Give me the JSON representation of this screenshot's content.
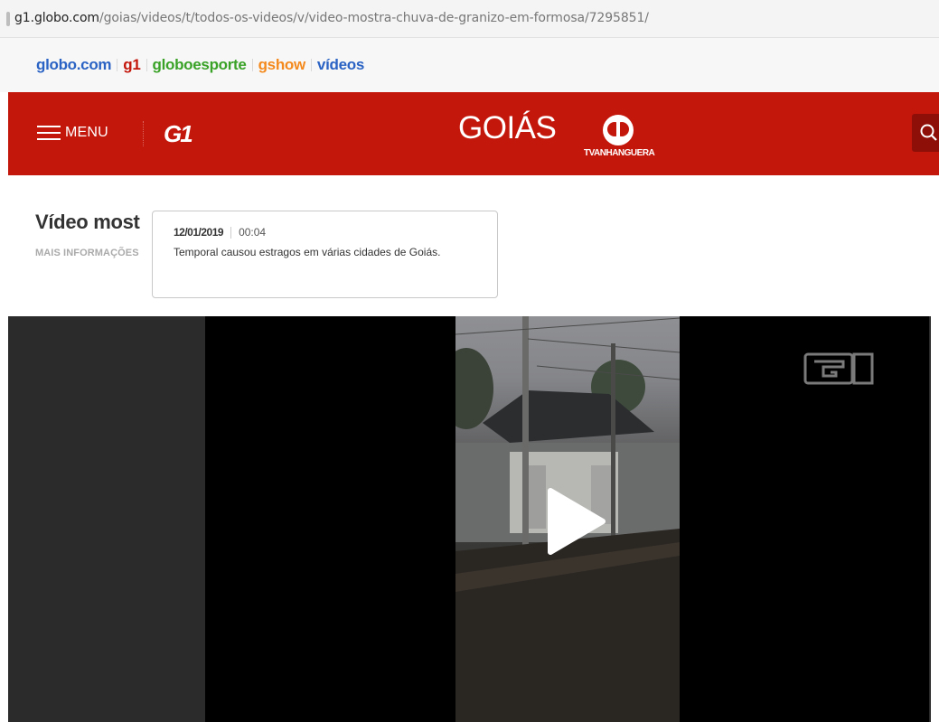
{
  "browser": {
    "url_host": "g1.globo.com",
    "url_path": "/goias/videos/t/todos-os-videos/v/video-mostra-chuva-de-granizo-em-formosa/7295851/"
  },
  "network_bar": {
    "items": [
      {
        "label": "globo.com",
        "color": "#2a63c4"
      },
      {
        "label": "g1",
        "color": "#c4170c"
      },
      {
        "label": "globoesporte",
        "color": "#39a227"
      },
      {
        "label": "gshow",
        "color": "#f48a1e"
      },
      {
        "label": "vídeos",
        "color": "#2a63c4"
      }
    ]
  },
  "header": {
    "menu_label": "MENU",
    "logo_text": "G1",
    "region_title": "GOIÁS",
    "affiliate_name": "TVANHANGUERA",
    "search_icon": "search-icon",
    "brand_color": "#c4170c"
  },
  "article": {
    "title_visible": "Vídeo most",
    "more_info_label": "MAIS INFORMAÇÕES"
  },
  "tooltip": {
    "date": "12/01/2019",
    "duration": "00:04",
    "description": "Temporal causou estragos em várias cidades de Goiás."
  },
  "player": {
    "watermark": "g1-logo-watermark",
    "play_icon": "play-icon"
  }
}
